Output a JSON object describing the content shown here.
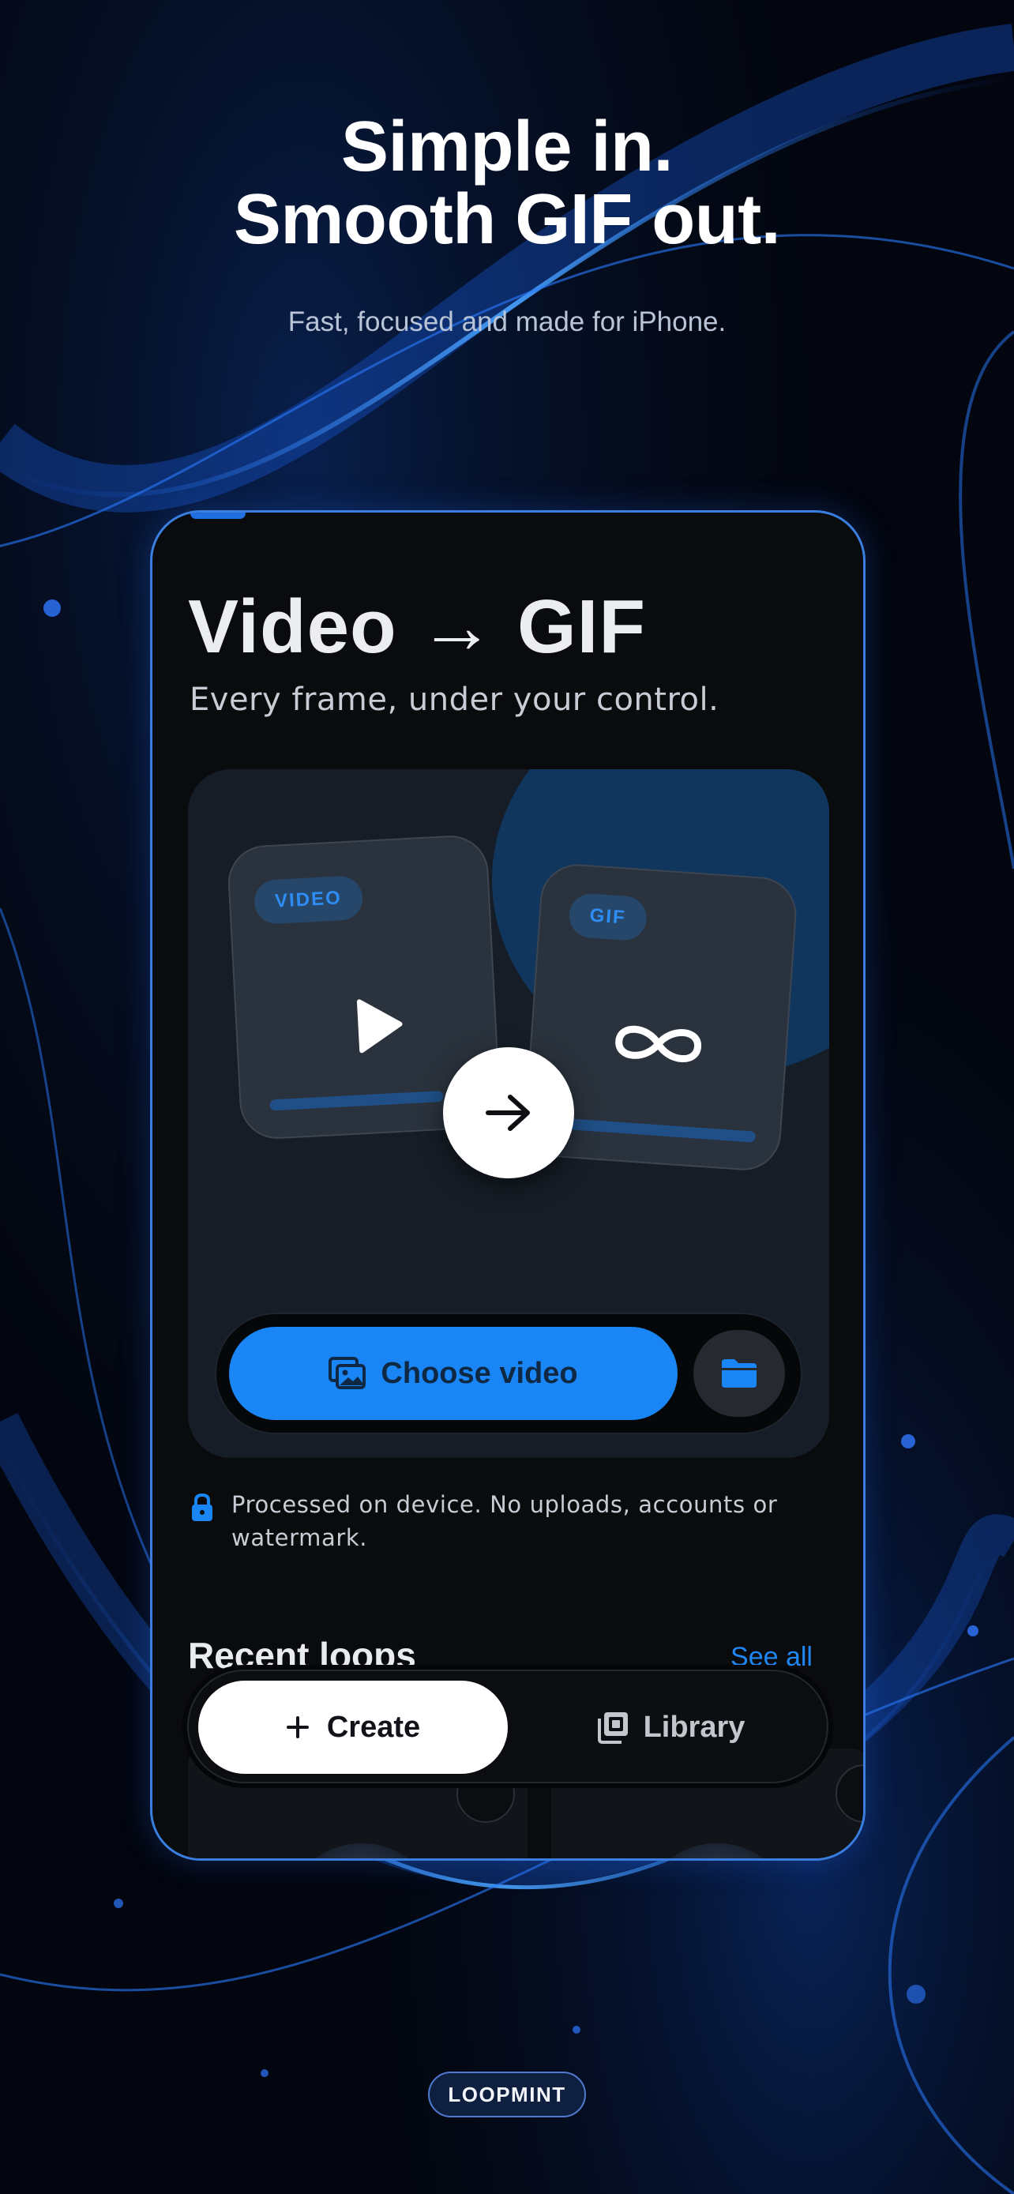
{
  "hero": {
    "title_line1": "Simple in.",
    "title_line2": "Smooth GIF out.",
    "subtitle": "Fast, focused and made for iPhone."
  },
  "app": {
    "title": "Video → GIF",
    "subtitle": "Every frame, under your control.",
    "illustration": {
      "video_label": "VIDEO",
      "gif_label": "GIF",
      "icons": [
        "play-icon",
        "infinity-icon",
        "arrow-right-icon"
      ]
    },
    "actions": {
      "choose_label": "Choose video",
      "choose_icon": "photo-library-icon",
      "folder_icon": "folder-icon"
    },
    "privacy": {
      "icon": "lock-icon",
      "text": "Processed on device. No uploads, accounts or watermark."
    },
    "recent": {
      "title": "Recent loops",
      "see_all": "See all"
    },
    "tabbar": {
      "create_label": "Create",
      "create_icon": "plus-icon",
      "library_label": "Library",
      "library_icon": "library-icon"
    }
  },
  "brand": "LOOPMINT",
  "colors": {
    "accent": "#1a86f5",
    "background": "#03060f",
    "card": "#161d26",
    "badge_text": "#2e8cf5"
  }
}
